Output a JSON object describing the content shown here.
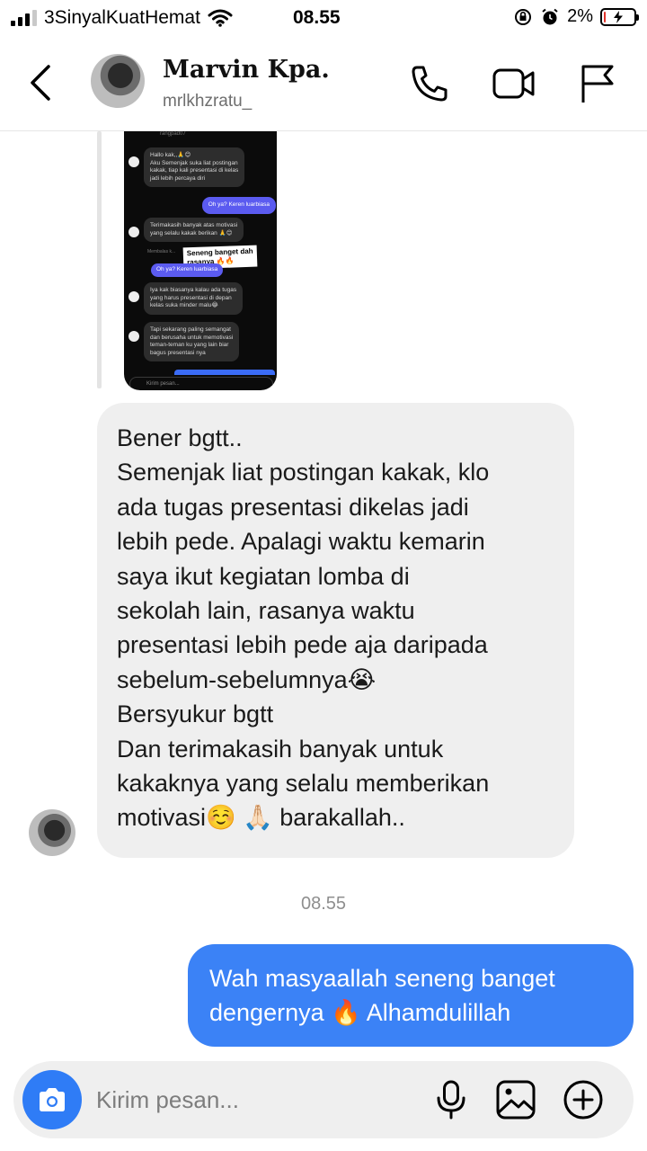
{
  "status_bar": {
    "carrier": "3SinyalKuatHemat",
    "time": "08.55",
    "battery": "2%",
    "battery_level": 0.02,
    "icons": [
      "signal-icon",
      "wifi-icon",
      "orientation-lock-icon",
      "alarm-icon",
      "battery-charging-icon"
    ]
  },
  "header": {
    "name": "Marvin Kpa.",
    "username": "mrlkhzratu_",
    "icons": [
      "back-icon",
      "phone-icon",
      "video-icon",
      "flag-icon"
    ]
  },
  "shared_screenshot": {
    "top_text": "rangpad07",
    "messages": [
      {
        "side": "left",
        "text": [
          "Hallo kak,,🙏😊",
          "Aku Semenjak suka liat postingan",
          "kakak, tiap kali presentasi di kelas",
          "jadi lebih percaya diri"
        ]
      },
      {
        "side": "right",
        "text": [
          "Oh ya? Keren luarbiasa"
        ]
      },
      {
        "side": "left",
        "text": [
          "Terimakasih banyak atas motivasi",
          "yang selalu kakak berikan 🙏😊"
        ]
      },
      {
        "side": "right",
        "text": [
          "Oh ya? Keren luarbiasa"
        ]
      },
      {
        "side": "left",
        "text": [
          "Iya kak biasanya kalau ada tugas",
          "yang harus presentasi di depan",
          "kelas suka minder malu😂"
        ]
      },
      {
        "side": "left",
        "text": [
          "Tapi sekarang paling semangat",
          "dan berusaha untuk memotivasi",
          "teman-teman ku yang lain biar",
          "bagus presentasi nya"
        ]
      }
    ],
    "sticker": [
      "Seneng banget dah",
      "rasanya 🔥🔥"
    ],
    "reply_label": "Membalas k...",
    "input_placeholder": "Kirim pesan..."
  },
  "received_message": {
    "lines": [
      "Bener bgtt..",
      "Semenjak liat postingan kakak, klo",
      "ada tugas presentasi dikelas jadi",
      "lebih pede. Apalagi waktu kemarin",
      "saya ikut kegiatan lomba di",
      "sekolah lain, rasanya waktu",
      "presentasi lebih pede aja daripada",
      "sebelum-sebelumnya😭",
      "Bersyukur bgtt",
      "Dan terimakasih banyak untuk",
      "kakaknya yang selalu memberikan",
      "motivasi☺️ 🙏🏻 barakallah.."
    ]
  },
  "timestamp": "08.55",
  "sent_message": {
    "lines": [
      "Wah masyaallah seneng banget",
      "dengernya 🔥 Alhamdulillah"
    ]
  },
  "composer": {
    "placeholder": "Kirim pesan...",
    "icons": [
      "camera-icon",
      "microphone-icon",
      "gallery-icon",
      "add-icon"
    ]
  },
  "colors": {
    "sent_bubble": "#3b82f6",
    "received_bubble": "#efefef",
    "camera_button": "#2f7cf6",
    "battery_low": "#e0332a"
  }
}
